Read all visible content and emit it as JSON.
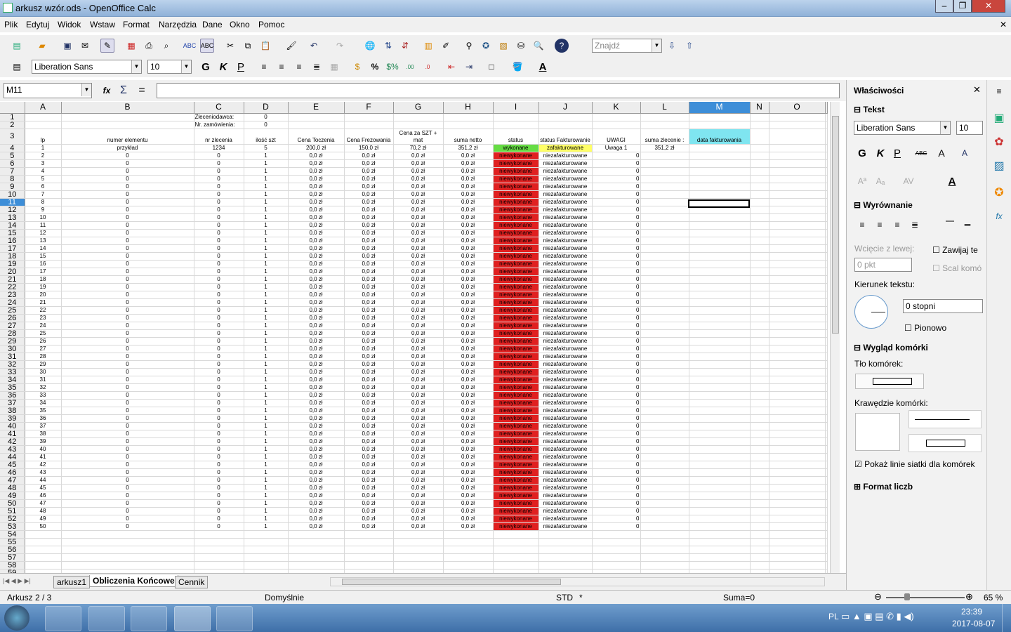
{
  "window": {
    "title": "arkusz wzór.ods - OpenOffice Calc"
  },
  "menu": [
    "Plik",
    "Edytuj",
    "Widok",
    "Wstaw",
    "Format",
    "Narzędzia",
    "Dane",
    "Okno",
    "Pomoc"
  ],
  "toolbar": {
    "find_placeholder": "Znajdź",
    "font_name": "Liberation Sans",
    "font_size": "10"
  },
  "formula": {
    "cell_ref": "M11",
    "value": ""
  },
  "columns": [
    "A",
    "B",
    "C",
    "D",
    "E",
    "F",
    "G",
    "H",
    "I",
    "J",
    "K",
    "L",
    "M",
    "N",
    "O"
  ],
  "header_rows": {
    "r1": {
      "C": "Zleceniodawca:",
      "D": "0"
    },
    "r2": {
      "C": "Nr. zamówienia:",
      "D": "0"
    },
    "r3": {
      "A": "lp",
      "B": "numer elementu",
      "C": "nr zlecenia",
      "D": "ilość szt",
      "E": "Cena Toczenia",
      "F": "Cena Frezowania",
      "G": "Cena za SZT + mat",
      "H": "suma netto",
      "I": "status",
      "J": "status Fakturowanie",
      "K": "UWAGI",
      "L": "suma zlecenie :",
      "M": "data fakturowania"
    },
    "r4": {
      "A": "1",
      "B": "przykład",
      "C": "1234",
      "D": "5",
      "E": "200,0 zł",
      "F": "150,0 zł",
      "G": "70,2 zł",
      "H": "351,2 zł",
      "I": "wykonane",
      "J": "zafakturowane",
      "K": "Uwaga 1",
      "L": "351,2 zł"
    }
  },
  "row_template": {
    "B": "0",
    "C": "0",
    "D": "1",
    "E": "0,0 zł",
    "F": "0,0 zł",
    "G": "0,0 zł",
    "H": "0,0 zł",
    "I": "niewykonane",
    "J": "niezafakturowane",
    "K": "0"
  },
  "data_lp_from": 2,
  "data_lp_to": 50,
  "sheet_tabs": [
    "arkusz1",
    "Obliczenia Końcowe",
    "Cennik"
  ],
  "active_tab": "Obliczenia Końcowe",
  "status": {
    "sheet": "Arkusz 2 / 3",
    "style": "Domyślnie",
    "mode": "STD",
    "modified": "*",
    "sum": "Suma=0",
    "zoom": "65 %"
  },
  "sidebar": {
    "title": "Właściwości",
    "text_section": "Tekst",
    "font": "Liberation Sans",
    "size": "10",
    "align_section": "Wyrównanie",
    "indent_label": "Wcięcie z lewej:",
    "indent_value": "0 pkt",
    "wrap_label": "Zawijaj te",
    "shrink_label": "Scal komó",
    "direction_label": "Kierunek tekstu:",
    "degrees": "0 stopni",
    "vertical_label": "Pionowo",
    "cell_section": "Wygląd komórki",
    "bg_label": "Tło komórek:",
    "border_label": "Krawędzie komórki:",
    "gridlines_label": "Pokaż linie siatki dla komórek",
    "number_section": "Format liczb"
  },
  "tray": {
    "lang": "PL",
    "time": "23:39",
    "date": "2017-08-07"
  }
}
